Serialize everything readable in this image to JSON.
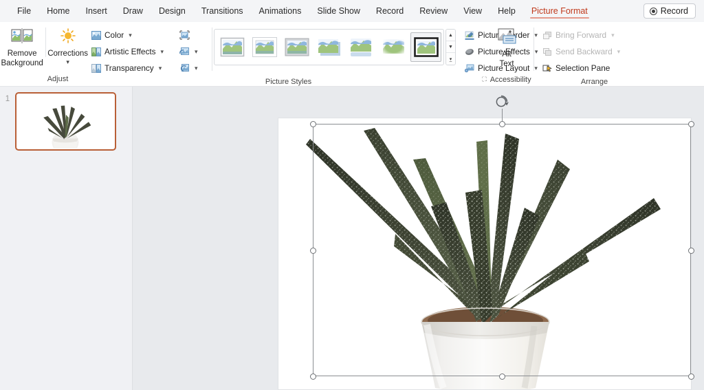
{
  "app": {
    "name": "Microsoft PowerPoint",
    "accent_color": "#c0391b",
    "ribbon_bg": "#ffffff",
    "menubar_bg": "#f4f5f7",
    "workspace_bg": "#e8eaed",
    "thumb_select_color": "#b95f36"
  },
  "menubar": {
    "tabs": [
      {
        "label": "File",
        "active": false
      },
      {
        "label": "Home",
        "active": false
      },
      {
        "label": "Insert",
        "active": false
      },
      {
        "label": "Draw",
        "active": false
      },
      {
        "label": "Design",
        "active": false
      },
      {
        "label": "Transitions",
        "active": false
      },
      {
        "label": "Animations",
        "active": false
      },
      {
        "label": "Slide Show",
        "active": false
      },
      {
        "label": "Record",
        "active": false
      },
      {
        "label": "Review",
        "active": false
      },
      {
        "label": "View",
        "active": false
      },
      {
        "label": "Help",
        "active": false
      },
      {
        "label": "Picture Format",
        "active": true
      }
    ],
    "record_button": {
      "label": "Record",
      "icon": "record-dot-icon"
    }
  },
  "ribbon": {
    "groups": [
      {
        "name": "adjust",
        "label": "Adjust",
        "big_buttons": [
          {
            "label": "Remove\nBackground",
            "line1": "Remove",
            "line2": "Background",
            "icon": "remove-background-icon",
            "caret": false
          },
          {
            "label": "Corrections",
            "line1": "Corrections",
            "line2": "",
            "icon": "corrections-sun-icon",
            "caret": true
          }
        ],
        "menu_buttons": [
          {
            "label": "Color",
            "icon": "color-picture-icon",
            "caret": true,
            "disabled": false
          },
          {
            "label": "Artistic Effects",
            "icon": "artistic-effects-icon",
            "caret": true,
            "disabled": false
          },
          {
            "label": "Transparency",
            "icon": "transparency-icon",
            "caret": true,
            "disabled": false
          }
        ],
        "icon_buttons": [
          {
            "name": "compress-pictures-icon",
            "caret": false
          },
          {
            "name": "change-picture-icon",
            "caret": true
          },
          {
            "name": "reset-picture-icon",
            "caret": true
          }
        ]
      },
      {
        "name": "picture-styles",
        "label": "Picture Styles",
        "gallery": {
          "items": [
            {
              "id": "simple-frame-white",
              "selected": false
            },
            {
              "id": "beveled-matte-white",
              "selected": false
            },
            {
              "id": "metal-frame",
              "selected": false
            },
            {
              "id": "drop-shadow-rectangle",
              "selected": false
            },
            {
              "id": "reflected-rounded-rectangle",
              "selected": false
            },
            {
              "id": "soft-edge-rectangle",
              "selected": false
            },
            {
              "id": "thick-black-frame",
              "selected": true
            }
          ],
          "scroll_buttons": [
            "scroll-up-icon",
            "scroll-down-icon",
            "more-styles-icon"
          ]
        },
        "menu_buttons": [
          {
            "label": "Picture Border",
            "icon": "picture-border-icon",
            "caret": true,
            "disabled": false
          },
          {
            "label": "Picture Effects",
            "icon": "picture-effects-icon",
            "caret": true,
            "disabled": false
          },
          {
            "label": "Picture Layout",
            "icon": "picture-layout-icon",
            "caret": true,
            "disabled": false
          }
        ]
      },
      {
        "name": "accessibility",
        "label": "Accessibility",
        "dialog_launcher": true,
        "big_buttons": [
          {
            "label": "Alt Text",
            "line1": "Alt",
            "line2": "Text",
            "icon": "alt-text-icon",
            "caret": false
          }
        ]
      },
      {
        "name": "arrange",
        "label": "Arrange",
        "menu_buttons": [
          {
            "label": "Bring Forward",
            "icon": "bring-forward-icon",
            "caret": true,
            "disabled": true
          },
          {
            "label": "Send Backward",
            "icon": "send-backward-icon",
            "caret": true,
            "disabled": true
          },
          {
            "label": "Selection Pane",
            "icon": "selection-pane-icon",
            "caret": false,
            "disabled": false
          }
        ]
      }
    ]
  },
  "thumbnail_pane": {
    "slides": [
      {
        "number": "1",
        "selected": true,
        "content": "succulent-plant-photo"
      }
    ]
  },
  "slide": {
    "picture": {
      "name": "succulent-plant-picture",
      "alt": "Haworthia zebra succulent in a white ceramic pot",
      "selected": true
    },
    "selection": {
      "handle_count": 8,
      "rotation_handle": "rotation-handle-icon",
      "handle_fill": "#ffffff",
      "handle_border": "#6d7074"
    }
  }
}
